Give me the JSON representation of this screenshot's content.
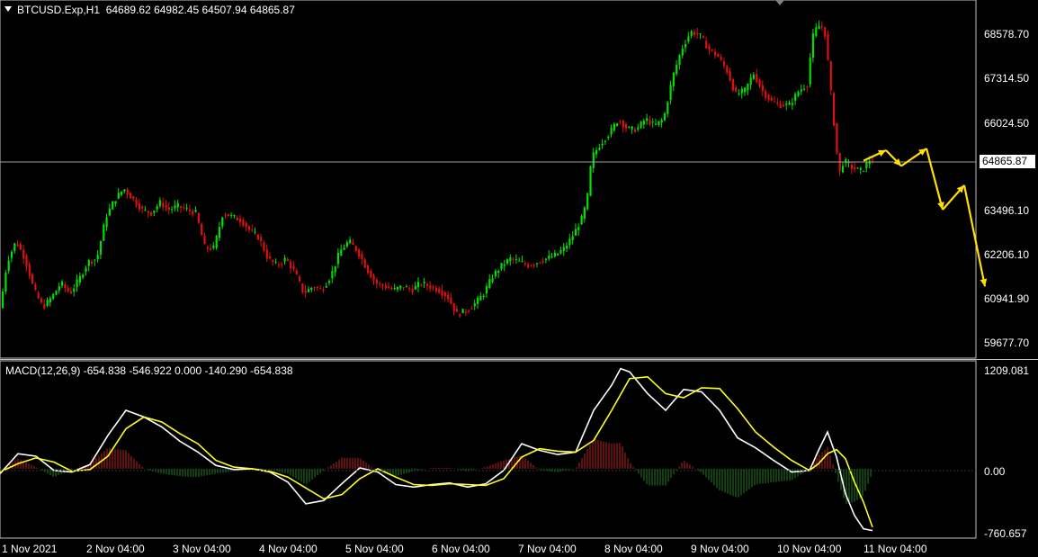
{
  "header": {
    "symbol": "BTCUSD.Exp,H1",
    "ohlc": "64689.62 64982.45 64507.94 64865.87"
  },
  "macd_header": {
    "label": "MACD(12,26,9) -654.838 -546.922 0.000 -140.290 -654.838"
  },
  "current_price": "64865.87",
  "price_axis": [
    "68578.70",
    "67314.50",
    "66024.50",
    "63496.10",
    "62206.10",
    "60941.90",
    "59677.70"
  ],
  "macd_axis": [
    "1209.081",
    "0.00",
    "-760.657"
  ],
  "time_axis": [
    "1 Nov 2021",
    "2 Nov 04:00",
    "3 Nov 04:00",
    "4 Nov 04:00",
    "5 Nov 04:00",
    "6 Nov 04:00",
    "7 Nov 04:00",
    "8 Nov 04:00",
    "9 Nov 04:00",
    "10 Nov 04:00",
    "11 Nov 04:00"
  ],
  "colors": {
    "bull": "#00e000",
    "bear": "#e01010",
    "macd_line": "#ffffff",
    "signal_line": "#ffff20",
    "hist_pos": "#c02020",
    "hist_neg": "#208020",
    "forecast": "#ffe000"
  },
  "chart_data": {
    "type": "candlestick",
    "price_points": [
      [
        0,
        60300
      ],
      [
        5,
        61000
      ],
      [
        10,
        61900
      ],
      [
        20,
        62500
      ],
      [
        30,
        62000
      ],
      [
        40,
        61100
      ],
      [
        50,
        60600
      ],
      [
        60,
        60900
      ],
      [
        70,
        61300
      ],
      [
        80,
        61000
      ],
      [
        90,
        61400
      ],
      [
        100,
        61900
      ],
      [
        110,
        62000
      ],
      [
        120,
        63200
      ],
      [
        130,
        63700
      ],
      [
        140,
        64000
      ],
      [
        150,
        63700
      ],
      [
        160,
        63400
      ],
      [
        170,
        63300
      ],
      [
        180,
        63600
      ],
      [
        190,
        63400
      ],
      [
        200,
        63500
      ],
      [
        210,
        63400
      ],
      [
        220,
        63300
      ],
      [
        230,
        62300
      ],
      [
        240,
        62300
      ],
      [
        250,
        63300
      ],
      [
        260,
        63200
      ],
      [
        270,
        63100
      ],
      [
        280,
        62800
      ],
      [
        290,
        62600
      ],
      [
        300,
        62000
      ],
      [
        310,
        61800
      ],
      [
        320,
        62000
      ],
      [
        330,
        61600
      ],
      [
        340,
        61000
      ],
      [
        350,
        61200
      ],
      [
        360,
        61100
      ],
      [
        370,
        61500
      ],
      [
        380,
        62200
      ],
      [
        390,
        62500
      ],
      [
        400,
        62200
      ],
      [
        410,
        61700
      ],
      [
        420,
        61300
      ],
      [
        430,
        61200
      ],
      [
        440,
        61100
      ],
      [
        450,
        61200
      ],
      [
        460,
        61100
      ],
      [
        470,
        61300
      ],
      [
        480,
        61200
      ],
      [
        490,
        61100
      ],
      [
        500,
        60900
      ],
      [
        510,
        60400
      ],
      [
        520,
        60500
      ],
      [
        530,
        60700
      ],
      [
        540,
        61000
      ],
      [
        550,
        61500
      ],
      [
        560,
        61800
      ],
      [
        570,
        62000
      ],
      [
        580,
        61900
      ],
      [
        590,
        61800
      ],
      [
        600,
        61900
      ],
      [
        610,
        62000
      ],
      [
        620,
        62100
      ],
      [
        630,
        62300
      ],
      [
        640,
        62700
      ],
      [
        650,
        63200
      ],
      [
        655,
        63700
      ],
      [
        660,
        64900
      ],
      [
        670,
        65300
      ],
      [
        680,
        65600
      ],
      [
        690,
        66000
      ],
      [
        700,
        65700
      ],
      [
        710,
        65700
      ],
      [
        720,
        66000
      ],
      [
        730,
        65800
      ],
      [
        740,
        66000
      ],
      [
        750,
        67200
      ],
      [
        760,
        68000
      ],
      [
        770,
        68500
      ],
      [
        780,
        68400
      ],
      [
        790,
        68000
      ],
      [
        800,
        67800
      ],
      [
        810,
        67400
      ],
      [
        820,
        66700
      ],
      [
        830,
        66800
      ],
      [
        840,
        67300
      ],
      [
        850,
        66800
      ],
      [
        860,
        66500
      ],
      [
        870,
        66400
      ],
      [
        880,
        66400
      ],
      [
        890,
        66800
      ],
      [
        900,
        67000
      ],
      [
        905,
        68300
      ],
      [
        910,
        68600
      ],
      [
        915,
        68700
      ],
      [
        920,
        68400
      ],
      [
        925,
        67000
      ],
      [
        930,
        65700
      ],
      [
        935,
        64400
      ],
      [
        940,
        64800
      ],
      [
        950,
        64600
      ],
      [
        960,
        64500
      ],
      [
        970,
        64865
      ]
    ],
    "macd_points": [
      [
        0,
        -60
      ],
      [
        20,
        180
      ],
      [
        40,
        150
      ],
      [
        60,
        -20
      ],
      [
        80,
        -40
      ],
      [
        100,
        50
      ],
      [
        120,
        400
      ],
      [
        140,
        700
      ],
      [
        160,
        620
      ],
      [
        180,
        500
      ],
      [
        200,
        330
      ],
      [
        220,
        200
      ],
      [
        240,
        40
      ],
      [
        260,
        -10
      ],
      [
        280,
        0
      ],
      [
        300,
        -40
      ],
      [
        320,
        -160
      ],
      [
        340,
        -420
      ],
      [
        360,
        -380
      ],
      [
        380,
        -180
      ],
      [
        400,
        10
      ],
      [
        420,
        -40
      ],
      [
        440,
        -190
      ],
      [
        460,
        -220
      ],
      [
        480,
        -190
      ],
      [
        500,
        -170
      ],
      [
        520,
        -220
      ],
      [
        540,
        -180
      ],
      [
        560,
        -20
      ],
      [
        580,
        300
      ],
      [
        600,
        220
      ],
      [
        620,
        170
      ],
      [
        640,
        200
      ],
      [
        660,
        700
      ],
      [
        680,
        1000
      ],
      [
        690,
        1200
      ],
      [
        700,
        1160
      ],
      [
        720,
        900
      ],
      [
        740,
        700
      ],
      [
        760,
        950
      ],
      [
        780,
        920
      ],
      [
        800,
        700
      ],
      [
        820,
        370
      ],
      [
        840,
        250
      ],
      [
        860,
        100
      ],
      [
        880,
        -40
      ],
      [
        900,
        -20
      ],
      [
        910,
        220
      ],
      [
        920,
        440
      ],
      [
        930,
        140
      ],
      [
        940,
        -300
      ],
      [
        950,
        -560
      ],
      [
        960,
        -720
      ],
      [
        970,
        -740
      ]
    ],
    "signal_points": [
      [
        0,
        -40
      ],
      [
        20,
        60
      ],
      [
        40,
        130
      ],
      [
        60,
        80
      ],
      [
        80,
        -30
      ],
      [
        100,
        -10
      ],
      [
        120,
        150
      ],
      [
        140,
        480
      ],
      [
        160,
        620
      ],
      [
        180,
        560
      ],
      [
        200,
        420
      ],
      [
        220,
        300
      ],
      [
        240,
        100
      ],
      [
        260,
        20
      ],
      [
        280,
        0
      ],
      [
        300,
        -30
      ],
      [
        320,
        -100
      ],
      [
        340,
        -230
      ],
      [
        360,
        -360
      ],
      [
        380,
        -310
      ],
      [
        400,
        -120
      ],
      [
        420,
        0
      ],
      [
        440,
        -100
      ],
      [
        460,
        -190
      ],
      [
        480,
        -200
      ],
      [
        500,
        -180
      ],
      [
        520,
        -190
      ],
      [
        540,
        -200
      ],
      [
        560,
        -120
      ],
      [
        580,
        140
      ],
      [
        600,
        240
      ],
      [
        620,
        210
      ],
      [
        640,
        200
      ],
      [
        660,
        340
      ],
      [
        680,
        700
      ],
      [
        700,
        1080
      ],
      [
        720,
        1100
      ],
      [
        740,
        900
      ],
      [
        760,
        850
      ],
      [
        780,
        970
      ],
      [
        800,
        960
      ],
      [
        820,
        720
      ],
      [
        840,
        440
      ],
      [
        860,
        260
      ],
      [
        880,
        100
      ],
      [
        900,
        -20
      ],
      [
        910,
        60
      ],
      [
        920,
        180
      ],
      [
        930,
        230
      ],
      [
        940,
        120
      ],
      [
        950,
        -160
      ],
      [
        960,
        -400
      ],
      [
        970,
        -700
      ]
    ],
    "price_range": [
      59300,
      69200
    ],
    "macd_range": [
      -820,
      1260
    ]
  },
  "forecast": [
    [
      960,
      64800
    ],
    [
      985,
      65100
    ],
    [
      1002,
      64650
    ],
    [
      1030,
      65150
    ],
    [
      1048,
      63400
    ],
    [
      1072,
      64100
    ],
    [
      1095,
      61200
    ]
  ]
}
